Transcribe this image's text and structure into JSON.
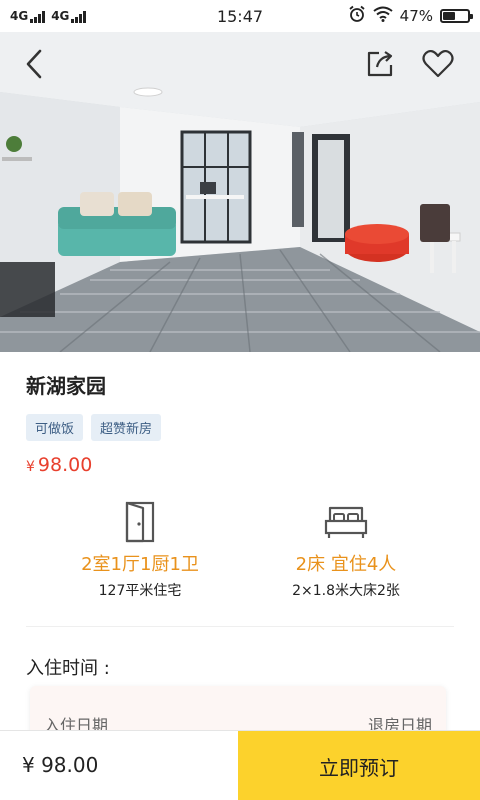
{
  "status_bar": {
    "network1": "4G",
    "network2": "4G",
    "time": "15:47",
    "battery": "47%",
    "battery_level": 0.47
  },
  "hero": {
    "back_icon": "chevron-left-icon",
    "share_icon": "share-icon",
    "favorite_icon": "heart-icon"
  },
  "listing": {
    "title": "新湖家园",
    "tags": [
      "可做饭",
      "超赞新房"
    ],
    "price_currency": "¥",
    "price_value": "98.00"
  },
  "features": {
    "rooms": {
      "icon": "door-icon",
      "main": "2室1厅1厨1卫",
      "sub": "127平米住宅"
    },
    "beds": {
      "icon": "bed-icon",
      "main": "2床 宜住4人",
      "sub": "2×1.8米大床2张"
    }
  },
  "checkin": {
    "title": "入住时间 :",
    "checkin_label": "入住日期",
    "checkout_label": "退房日期"
  },
  "bottom_bar": {
    "price": "¥ 98.00",
    "book_label": "立即预订"
  },
  "colors": {
    "price_red": "#e8402e",
    "feature_orange": "#e9921c",
    "tag_bg": "#e6eef6",
    "tag_text": "#3e5f85",
    "book_yellow": "#fcd22c"
  }
}
